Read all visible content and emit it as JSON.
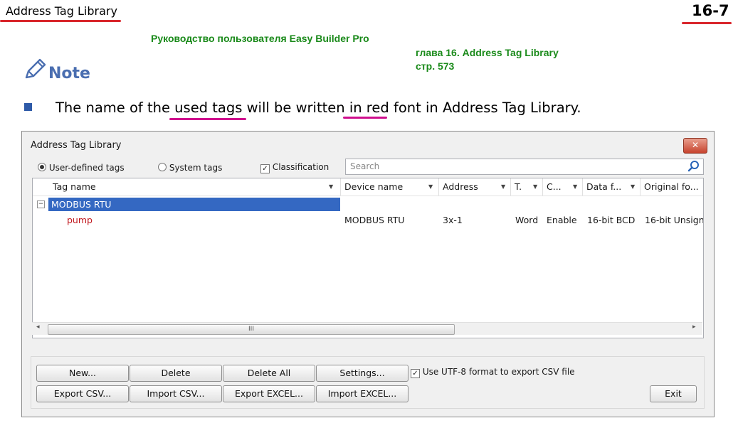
{
  "page": {
    "header_title": "Address Tag Library",
    "page_number": "16-7",
    "ru_line1": "Руководство пользователя Easy Builder Pro",
    "ru_line2": "глава 16. Address Tag Library",
    "ru_line3": "стр. 573",
    "note_label": "Note",
    "sentence": {
      "p1": "The name of the",
      "p2": "used tags",
      "p3": "will be written",
      "p4": "in red",
      "p5": "font in Address Tag Library."
    }
  },
  "dialog": {
    "title": "Address Tag Library",
    "close_glyph": "✕",
    "options": {
      "user_defined": "User-defined tags",
      "system": "System tags",
      "classification": "Classification",
      "classification_checked": true,
      "selected_radio": "user_defined"
    },
    "search_placeholder": "Search",
    "columns": [
      "Tag name",
      "Device name",
      "Address",
      "T.",
      "C...",
      "Data f...",
      "Original fo..."
    ],
    "group": {
      "expander": "⊟",
      "name": "MODBUS RTU"
    },
    "row": {
      "tag": "pump",
      "device": "MODBUS RTU",
      "address": "3x-1",
      "type": "Word",
      "c": "Enable",
      "data_format": "16-bit BCD",
      "original_format": "16-bit Unsign"
    },
    "scroll_grip": "III",
    "buttons": {
      "new": "New...",
      "delete": "Delete",
      "delete_all": "Delete All",
      "settings": "Settings...",
      "export_csv": "Export CSV...",
      "import_csv": "Import CSV...",
      "export_excel": "Export EXCEL...",
      "import_excel": "Import EXCEL...",
      "exit": "Exit"
    },
    "utf8": {
      "label": "Use UTF-8 format to export CSV file",
      "checked": true
    }
  },
  "colors": {
    "header_underline": "#d9262c",
    "green_text": "#1a8a1a",
    "note_blue": "#4a6eb0",
    "highlight_underline": "#d0108e",
    "used_tag_red": "#c0161c",
    "selection": "#3468c2"
  }
}
